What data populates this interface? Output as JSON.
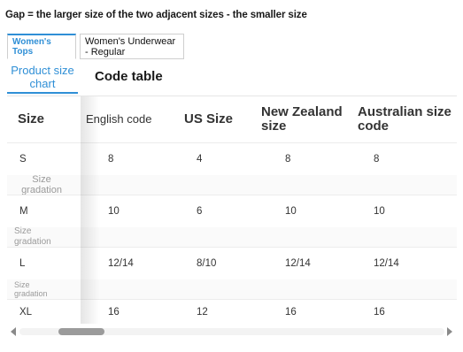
{
  "note": "Gap = the larger size of the two adjacent sizes - the smaller size",
  "tabs": [
    {
      "label": "Women's Tops",
      "active": true
    },
    {
      "label": "Women's Underwear - Regular",
      "active": false
    }
  ],
  "subtabs": {
    "chart": "Product size chart",
    "code": "Code table"
  },
  "table": {
    "headers": [
      "Size",
      "English code",
      "US Size",
      "New Zealand size",
      "Australian size code"
    ],
    "rows": [
      {
        "size": "S",
        "english": "8",
        "us": "4",
        "nz": "8",
        "au": "8"
      },
      {
        "size": "M",
        "english": "10",
        "us": "6",
        "nz": "10",
        "au": "10"
      },
      {
        "size": "L",
        "english": "12/14",
        "us": "8/10",
        "nz": "12/14",
        "au": "12/14"
      },
      {
        "size": "XL",
        "english": "16",
        "us": "12",
        "nz": "16",
        "au": "16"
      }
    ],
    "gap_label": "Size gradation"
  },
  "colors": {
    "accent": "#2f8fd6",
    "text": "#333333",
    "muted": "#9a9a9a"
  }
}
